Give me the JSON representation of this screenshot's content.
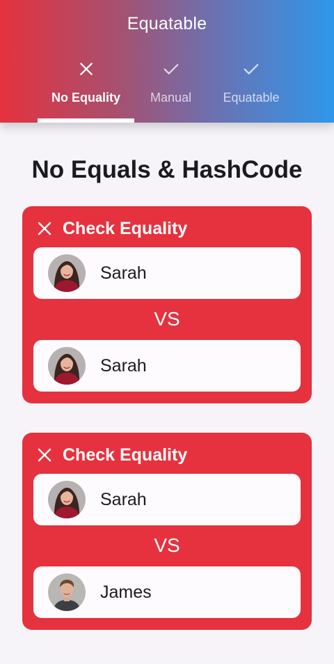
{
  "appbar": {
    "title": "Equatable"
  },
  "tabs": [
    {
      "label": "No Equality",
      "icon": "close-icon",
      "selected": true
    },
    {
      "label": "Manual",
      "icon": "check-icon",
      "selected": false
    },
    {
      "label": "Equatable",
      "icon": "check-icon",
      "selected": false
    }
  ],
  "heading": "No Equals & HashCode",
  "cards": [
    {
      "title": "Check Equality",
      "status_icon": "close-icon",
      "vs": "VS",
      "person_a": {
        "name": "Sarah",
        "avatar": "avatar-sarah"
      },
      "person_b": {
        "name": "Sarah",
        "avatar": "avatar-sarah"
      }
    },
    {
      "title": "Check Equality",
      "status_icon": "close-icon",
      "vs": "VS",
      "person_a": {
        "name": "Sarah",
        "avatar": "avatar-sarah"
      },
      "person_b": {
        "name": "James",
        "avatar": "avatar-james"
      }
    }
  ],
  "colors": {
    "card_background": "#e5323e",
    "gradient_start": "#e5323e",
    "gradient_end": "#2f97ea",
    "page_background": "#f6f4f9"
  }
}
